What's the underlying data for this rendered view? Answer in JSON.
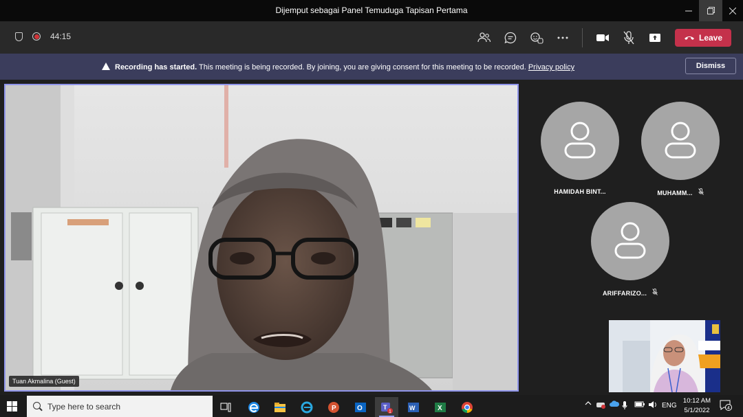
{
  "window": {
    "title": "Dijemput sebagai Panel Temuduga Tapisan Pertama",
    "min_icon": "minimize-icon",
    "max_icon": "restore-icon",
    "close_icon": "close-icon"
  },
  "toolbar": {
    "timer": "44:15",
    "leave_label": "Leave",
    "icons": [
      "shield-icon",
      "record-icon",
      "people-icon",
      "chat-icon",
      "react-icon",
      "more-icon",
      "camera-icon",
      "mic-off-icon",
      "share-icon"
    ]
  },
  "banner": {
    "bold_text": "Recording has started.",
    "text": " This meeting is being recorded. By joining, you are giving consent for this meeting to be recorded.",
    "link_text": "Privacy policy",
    "dismiss_label": "Dismiss"
  },
  "main_video": {
    "name": "Tuan Akmalina (Guest)",
    "border_color": "#8f94ea"
  },
  "participants": [
    {
      "name": "HAMIDAH BINT...",
      "muted": false
    },
    {
      "name": "MUHAMM...",
      "muted": true
    },
    {
      "name": "ARIFFARIZO...",
      "muted": true
    }
  ],
  "taskbar": {
    "search_placeholder": "Type here to search",
    "language": "ENG",
    "time": "10:12 AM",
    "date": "5/1/2022",
    "notification_count": "4",
    "teams_badge": "1"
  },
  "colors": {
    "leave": "#c4314b",
    "banner": "#3b3d5c",
    "avatar": "#a6a6a6"
  }
}
